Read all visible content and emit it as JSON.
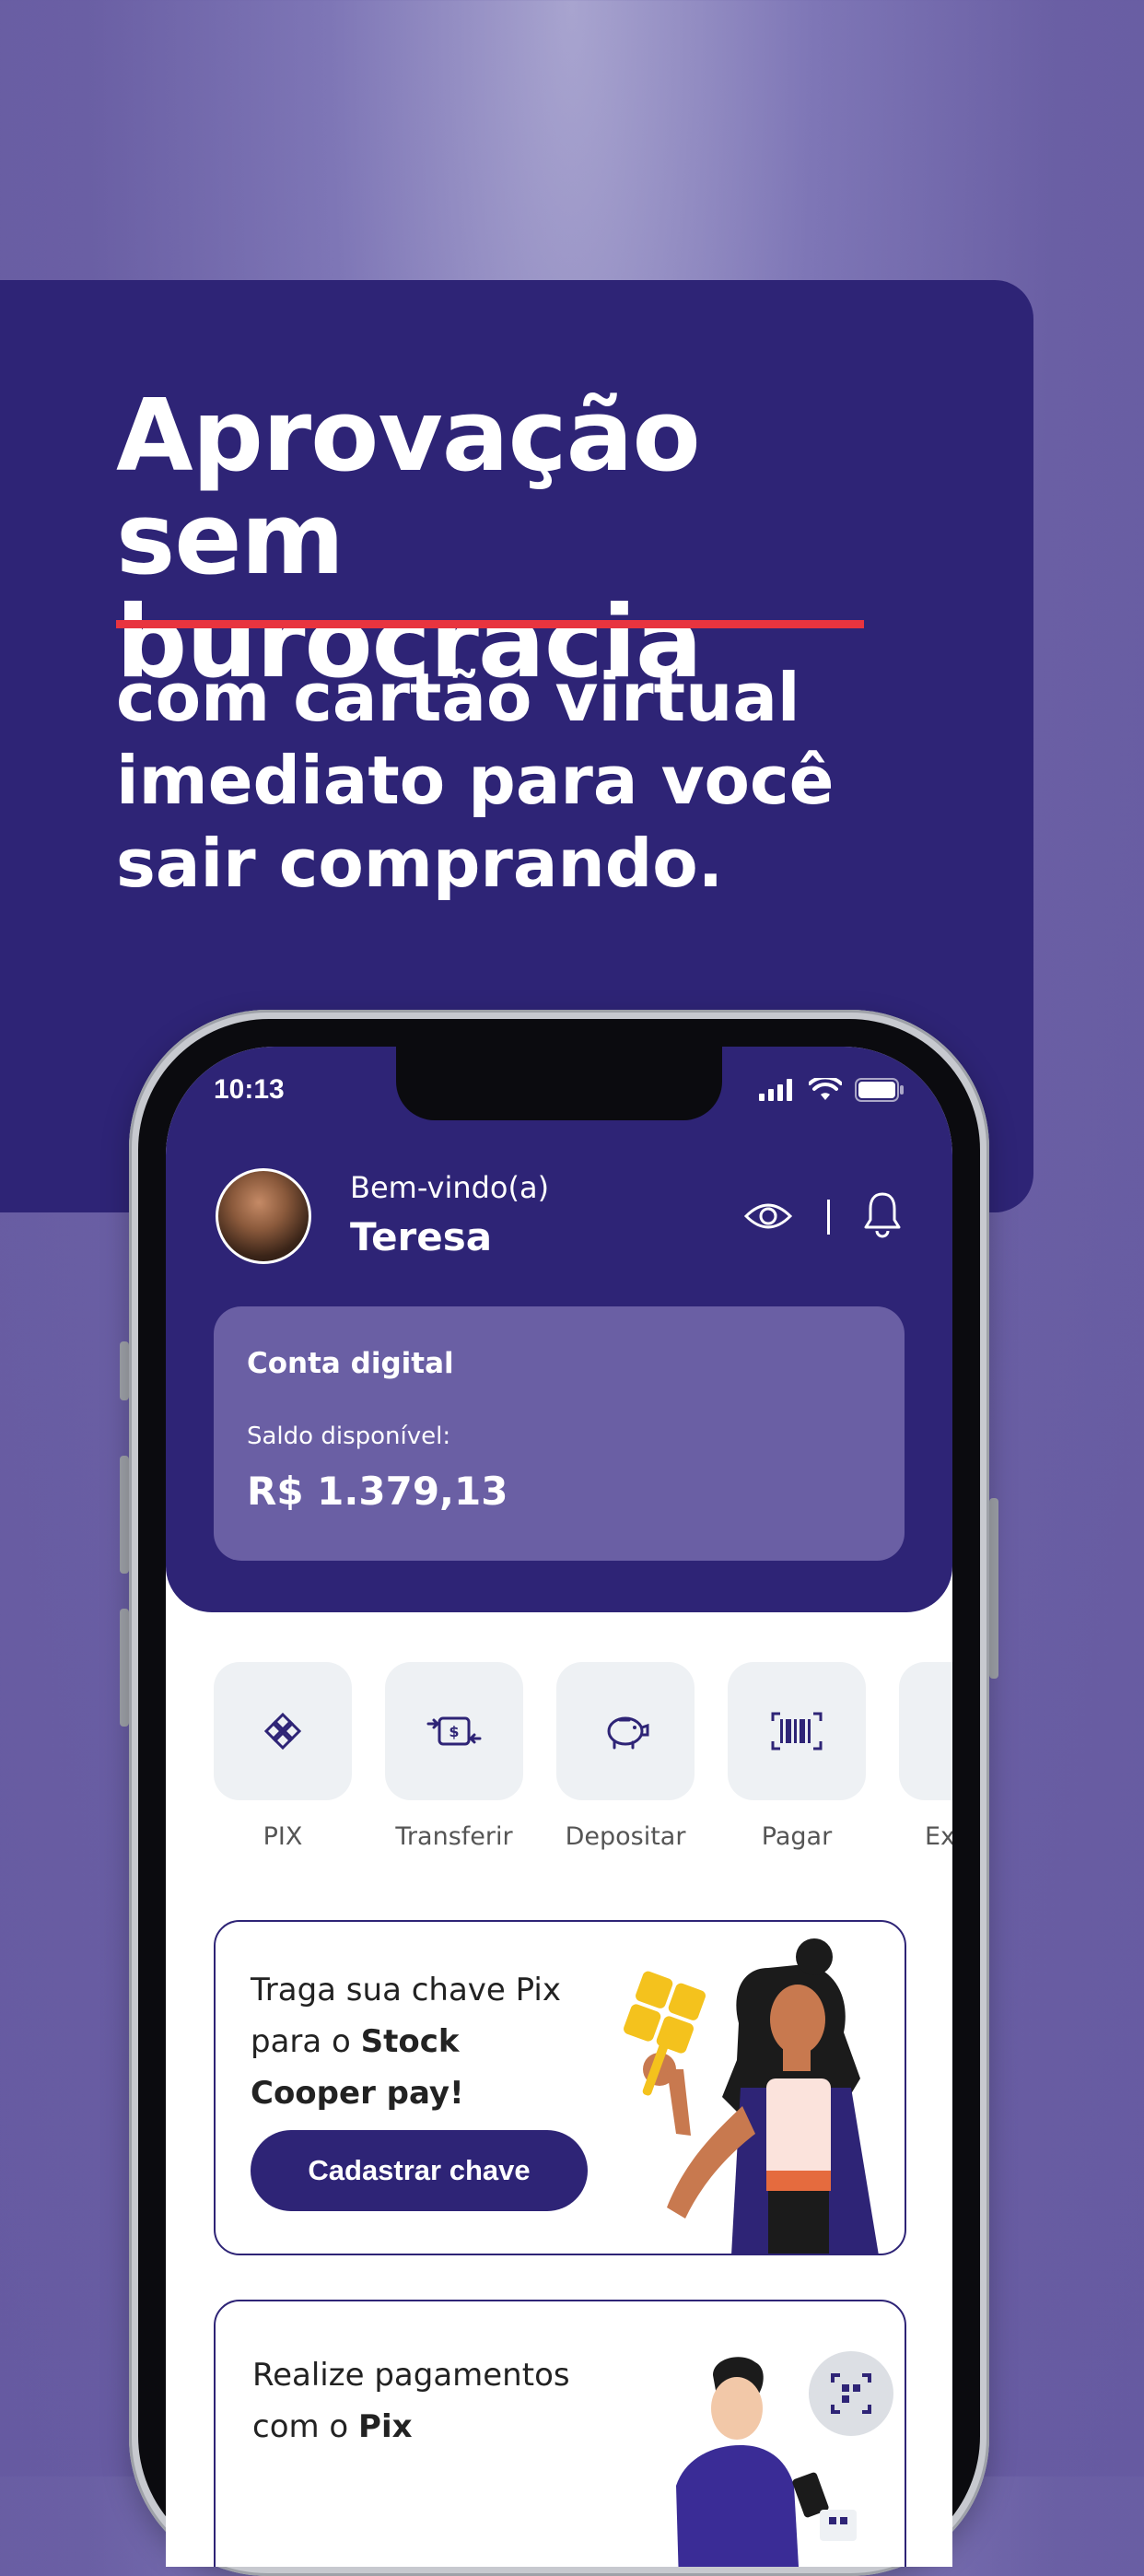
{
  "marketing": {
    "headline_line1": "Aprovação sem",
    "headline_line2": "burocracia",
    "subline_line1": "com cartão virtual",
    "subline_line2": "imediato para você",
    "subline_line3": "sair comprando.",
    "accent_color": "#e8343f",
    "brand_color": "#2e2476"
  },
  "status_bar": {
    "time": "10:13",
    "icons": [
      "signal-icon",
      "wifi-icon",
      "battery-icon"
    ]
  },
  "header": {
    "welcome": "Bem-vindo(a)",
    "user_name": "Teresa",
    "icons": [
      "eye-icon",
      "bell-icon"
    ]
  },
  "account": {
    "title": "Conta digital",
    "balance_label": "Saldo disponível:",
    "balance_value": "R$ 1.379,13"
  },
  "actions": [
    {
      "label": "PIX",
      "icon": "pix-icon"
    },
    {
      "label": "Transferir",
      "icon": "transfer-icon"
    },
    {
      "label": "Depositar",
      "icon": "piggy-bank-icon"
    },
    {
      "label": "Pagar",
      "icon": "barcode-icon"
    },
    {
      "label": "Ex",
      "icon": "more-icon"
    }
  ],
  "promo": {
    "text_line1": "Traga sua chave Pix",
    "text_line2_prefix": "para o ",
    "text_line2_bold": "Stock",
    "text_line3_bold": "Cooper pay!",
    "button_label": "Cadastrar chave"
  },
  "promo2": {
    "text_line1": "Realize pagamentos",
    "text_line2_prefix": "com o ",
    "text_line2_bold": "Pix"
  }
}
